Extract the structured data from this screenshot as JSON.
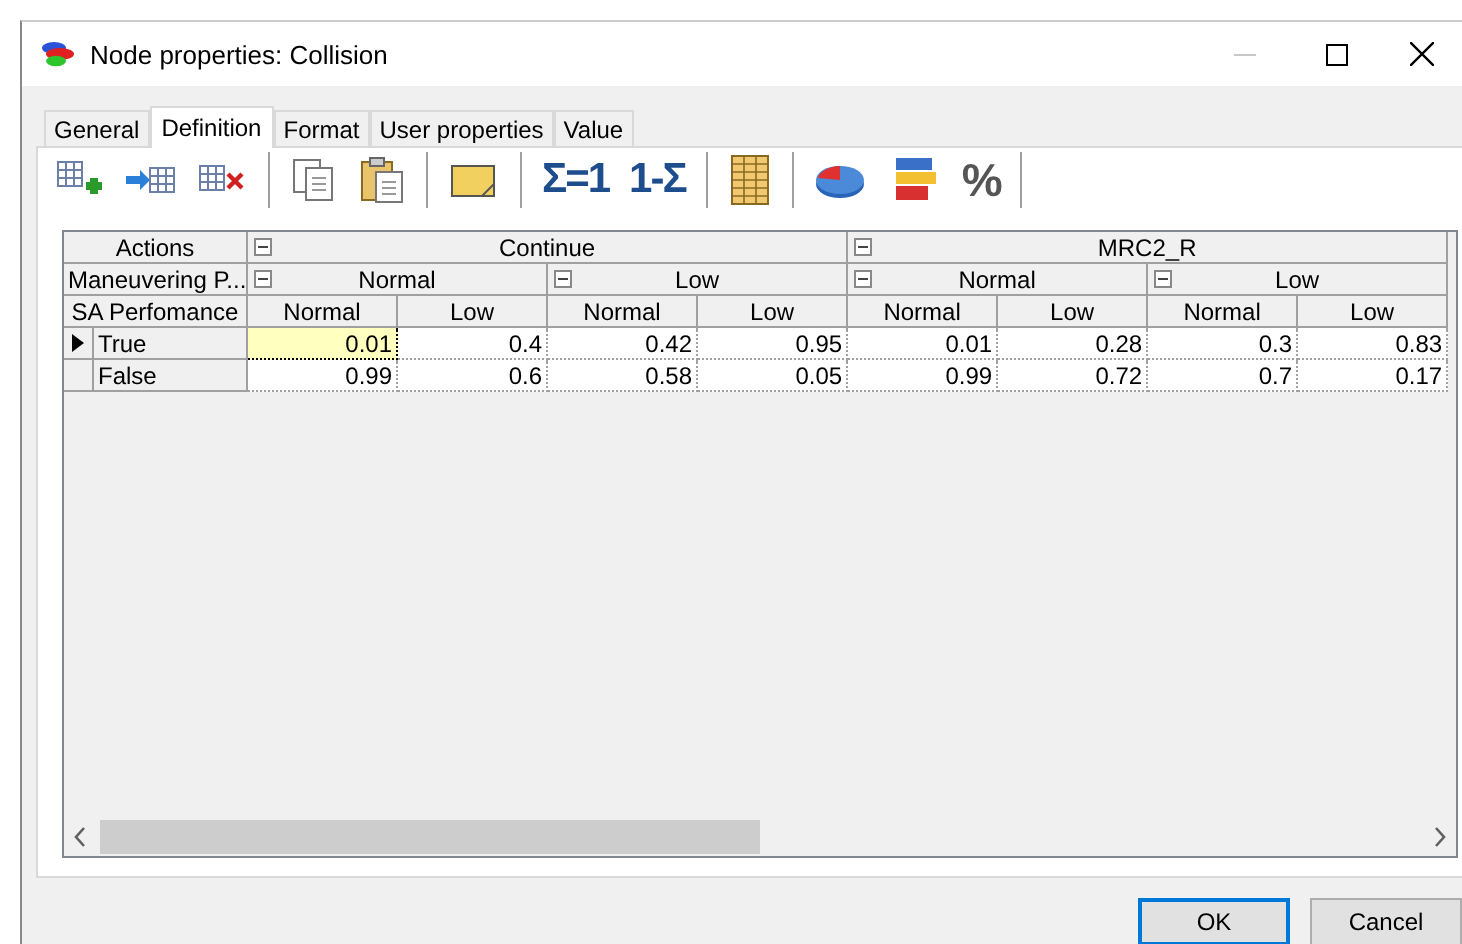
{
  "window": {
    "title": "Node properties: Collision"
  },
  "tabs": [
    {
      "label": "General",
      "selected": false
    },
    {
      "label": "Definition",
      "selected": true
    },
    {
      "label": "Format",
      "selected": false
    },
    {
      "label": "User properties",
      "selected": false
    },
    {
      "label": "Value",
      "selected": false
    }
  ],
  "toolbar": {
    "sum_to_one": "Σ=1",
    "complement": "1-Σ",
    "percent": "%"
  },
  "table": {
    "header_labels": [
      "Actions",
      "Maneuvering P...",
      "SA Perfomance"
    ],
    "header_tree": [
      {
        "label": "Continue",
        "expanded": true,
        "children": [
          {
            "label": "Normal",
            "expanded": true,
            "children": [
              {
                "label": "Normal"
              },
              {
                "label": "Low"
              }
            ]
          },
          {
            "label": "Low",
            "expanded": true,
            "children": [
              {
                "label": "Normal"
              },
              {
                "label": "Low"
              }
            ]
          }
        ]
      },
      {
        "label": "MRC2_R",
        "expanded": true,
        "children": [
          {
            "label": "Normal",
            "expanded": true,
            "children": [
              {
                "label": "Normal"
              },
              {
                "label": "Low"
              }
            ]
          },
          {
            "label": "Low",
            "expanded": true,
            "children": [
              {
                "label": "Normal"
              },
              {
                "label": "Low"
              }
            ]
          }
        ]
      }
    ],
    "rows": [
      {
        "label": "True",
        "current": true,
        "cells": [
          {
            "value": "0.01",
            "selected": true
          },
          {
            "value": "0.4",
            "selected": false
          },
          {
            "value": "0.42",
            "selected": false
          },
          {
            "value": "0.95",
            "selected": false
          },
          {
            "value": "0.01",
            "selected": false
          },
          {
            "value": "0.28",
            "selected": false
          },
          {
            "value": "0.3",
            "selected": false
          },
          {
            "value": "0.83",
            "selected": false
          }
        ]
      },
      {
        "label": "False",
        "current": false,
        "cells": [
          {
            "value": "0.99",
            "selected": false
          },
          {
            "value": "0.6",
            "selected": false
          },
          {
            "value": "0.58",
            "selected": false
          },
          {
            "value": "0.05",
            "selected": false
          },
          {
            "value": "0.99",
            "selected": false
          },
          {
            "value": "0.72",
            "selected": false
          },
          {
            "value": "0.7",
            "selected": false
          },
          {
            "value": "0.17",
            "selected": false
          }
        ]
      }
    ]
  },
  "buttons": [
    {
      "label": "OK",
      "default": true
    },
    {
      "label": "Cancel",
      "default": false
    }
  ]
}
